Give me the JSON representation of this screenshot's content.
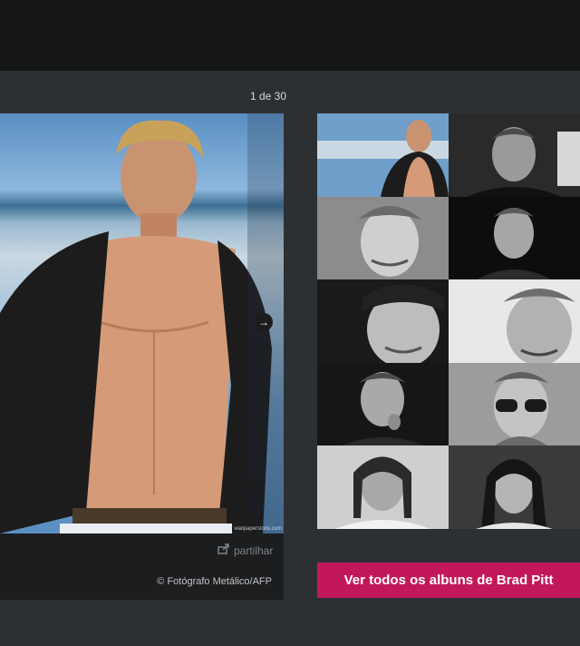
{
  "gallery": {
    "counter": "1 de 30",
    "watermark": "wallpaperstock.com",
    "share_label": "partilhar",
    "credit": "© Fotógrafo Metálico/AFP",
    "albums_button": "Ver todos os albuns de Brad Pitt",
    "colors": {
      "accent": "#c2185b",
      "background": "#2d3033",
      "topbar": "#141515",
      "caption_bar": "#1c1d1e"
    },
    "icons": {
      "share": "share-icon",
      "next": "arrow-right-icon"
    },
    "thumbnails": [
      {
        "label": "thumbnail-1"
      },
      {
        "label": "thumbnail-2"
      },
      {
        "label": "thumbnail-3"
      },
      {
        "label": "thumbnail-4"
      },
      {
        "label": "thumbnail-5"
      },
      {
        "label": "thumbnail-6"
      },
      {
        "label": "thumbnail-7"
      },
      {
        "label": "thumbnail-8"
      },
      {
        "label": "thumbnail-9"
      },
      {
        "label": "thumbnail-10"
      }
    ]
  }
}
